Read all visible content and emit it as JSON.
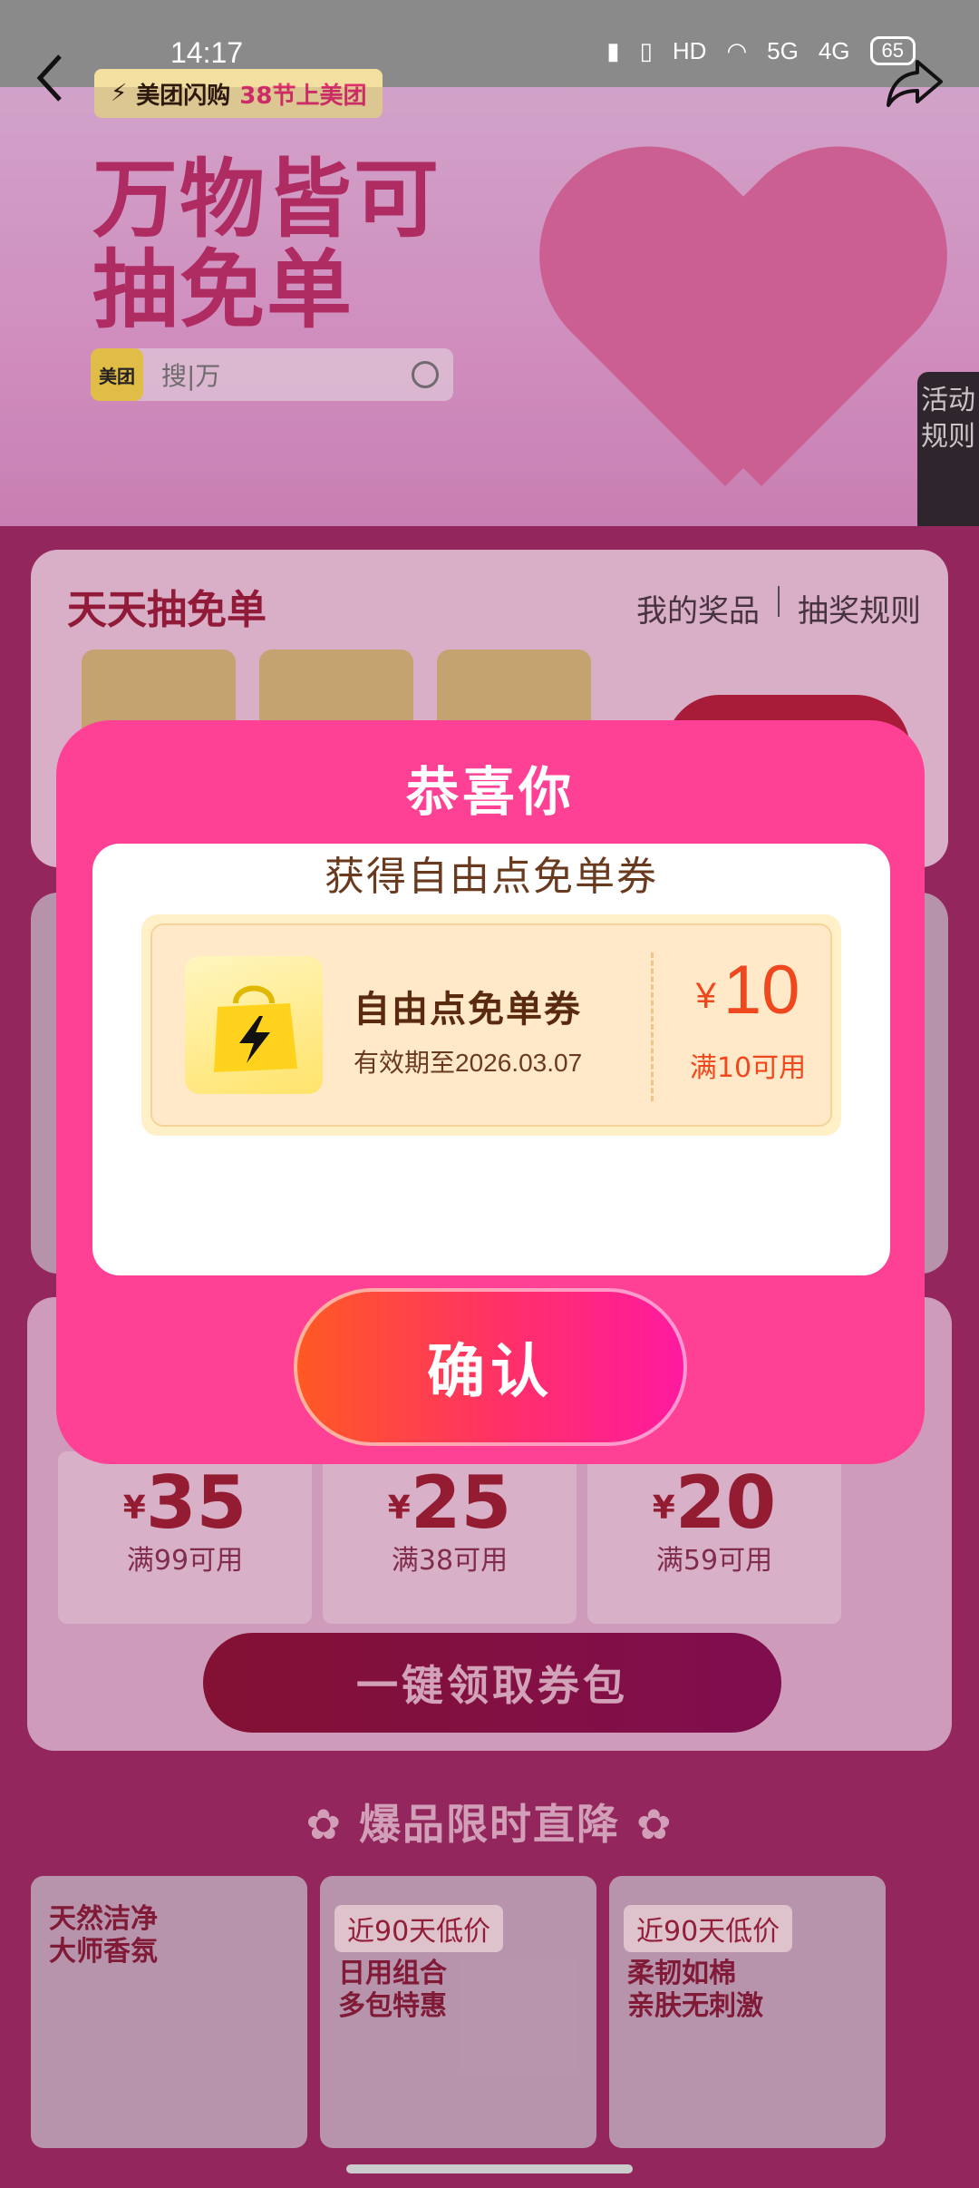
{
  "status_bar": {
    "time": "14:17",
    "hd": "HD",
    "net1": "5G",
    "net2": "4G",
    "battery": "65"
  },
  "header": {
    "brand": "美团闪购",
    "campaign": "38节上美团",
    "slogan_line1": "万物皆可",
    "slogan_line2": "抽免单",
    "search_brand": "美团",
    "search_placeholder": "搜|万"
  },
  "side_tab": {
    "label_line1": "活动",
    "label_line2": "规则"
  },
  "daily_draw": {
    "title": "天天抽免单",
    "my_prizes": "我的奖品",
    "rules": "抽奖规则"
  },
  "coupon_pack": {
    "items": [
      {
        "currency": "¥",
        "amount": "35",
        "condition": "满99可用"
      },
      {
        "currency": "¥",
        "amount": "25",
        "condition": "满38可用"
      },
      {
        "currency": "¥",
        "amount": "20",
        "condition": "满59可用"
      }
    ],
    "get_all_button": "一键领取券包"
  },
  "hot_deals": {
    "title": "爆品限时直降",
    "products": [
      {
        "line1": "天然洁净",
        "line2": "大师香氛"
      },
      {
        "badge": "近90天低价",
        "line1": "日用组合",
        "line2": "多包特惠"
      },
      {
        "badge": "近90天低价",
        "line1": "柔韧如棉",
        "line2": "亲肤无刺激"
      }
    ]
  },
  "modal": {
    "title": "恭喜你",
    "subtitle": "获得自由点免单券",
    "voucher": {
      "name": "自由点免单券",
      "validity": "有效期至2026.03.07",
      "currency": "¥",
      "amount": "10",
      "condition": "满10可用"
    },
    "confirm_button": "确认"
  },
  "colors": {
    "modal_bg": "#ff4196",
    "accent_red": "#f0481e",
    "confirm_gradient_start": "#ff5a22",
    "confirm_gradient_end": "#ff1aa0"
  }
}
